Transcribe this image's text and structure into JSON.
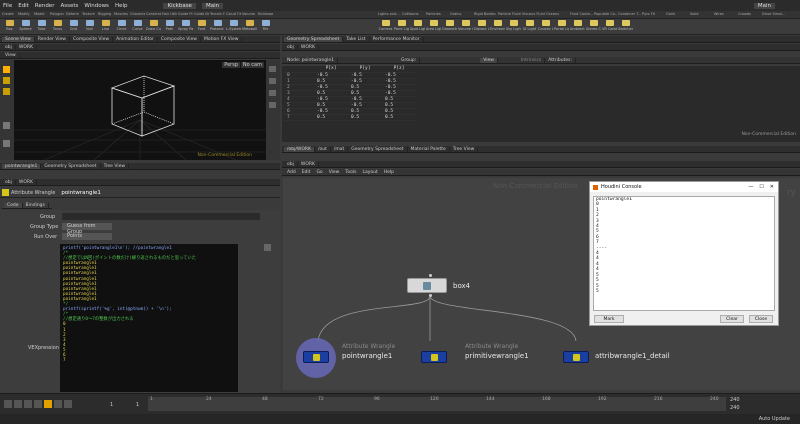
{
  "menubar": {
    "items": [
      "File",
      "Edit",
      "Render",
      "Assets",
      "Windows",
      "Help"
    ],
    "kickbase": "Kickbase",
    "main": "Main",
    "main_right": "Main"
  },
  "shelf_tabs_left": [
    "Create",
    "Modify",
    "Model",
    "Polygon",
    "Deform",
    "Texture",
    "Rigging",
    "Muscles",
    "Characters",
    "Constraints",
    "Hair Utils",
    "Guide Pro",
    "Guide Bru",
    "Terrain FX",
    "Cloud FX",
    "Volume",
    "Kickbase"
  ],
  "shelf_tabs_right": [
    "Lights and...",
    "Collisions",
    "Particles",
    "Grains",
    "Rigid Bodies",
    "Particle Fluids",
    "Viscous Fluids",
    "Oceans",
    "Fluid Conta...",
    "Populate Co...",
    "Container T...",
    "Pyro FX",
    "Cloth",
    "Solid",
    "Wires",
    "Crowds",
    "Drive Simul..."
  ],
  "shelf_tools_left": [
    "Box",
    "Sphere",
    "Tube",
    "Torus",
    "Grid",
    "Null",
    "Line",
    "Circle",
    "Curve",
    "Draw Curve",
    "Path",
    "Spray Paint",
    "Font",
    "Platonic Solids",
    "L-System",
    "Metaball",
    "File"
  ],
  "shelf_tools_right": [
    "Camera",
    "Point Light",
    "Spot Light",
    "Area Light",
    "Geometry Light",
    "Volume Light",
    "Distant Light",
    "Environment Light",
    "Sky Light",
    "GI Light",
    "Caustic Light",
    "Portal Light",
    "Ambient Light",
    "Stereo Camera",
    "VR Camera",
    "Switcher"
  ],
  "left_tabs": [
    "Scene View",
    "Render View",
    "Composite View",
    "Animation Editor",
    "Composite View",
    "Motion FX View"
  ],
  "obj_path": "obj",
  "work": "WORK",
  "viewport": {
    "label": "View",
    "persp": "Persp",
    "nocam": "No cam",
    "watermark": "Non-Commercial Edition"
  },
  "spreadsheet": {
    "tabs": [
      "Geometry Spreadsheet",
      "Take List",
      "Performance Monitor"
    ],
    "obj": "obj",
    "work": "WORK",
    "node_label": "Node: pointwrangle1",
    "group": "Group:",
    "view": "View",
    "intrinsics": "Intrinsics",
    "attributes": "Attributes:",
    "columns": [
      "P[x]",
      "P[y]",
      "P[z]"
    ],
    "rows": [
      [
        "0",
        "-0.5",
        "-0.5",
        "-0.5"
      ],
      [
        "1",
        "0.5",
        "-0.5",
        "-0.5"
      ],
      [
        "2",
        "-0.5",
        "0.5",
        "-0.5"
      ],
      [
        "3",
        "0.5",
        "0.5",
        "-0.5"
      ],
      [
        "4",
        "-0.5",
        "-0.5",
        "0.5"
      ],
      [
        "5",
        "0.5",
        "-0.5",
        "0.5"
      ],
      [
        "6",
        "-0.5",
        "0.5",
        "0.5"
      ],
      [
        "7",
        "0.5",
        "0.5",
        "0.5"
      ]
    ],
    "watermark": "Non-Commercial Edition"
  },
  "param": {
    "tabs": [
      "pointwrangle1",
      "Geometry Spreadsheet",
      "Tree View"
    ],
    "obj": "obj",
    "work": "WORK",
    "node_type": "Attribute Wrangle",
    "node_name": "pointwrangle1",
    "subtabs": [
      "Code",
      "Bindings"
    ],
    "group_label": "Group",
    "group_type_label": "Group Type",
    "group_type_value": "Guess from Group",
    "run_over_label": "Run Over",
    "run_over_value": "Points",
    "vex_label": "VEXpression"
  },
  "code_lines": [
    "printf('pointwrangle1\\n'); //pointwrangle1",
    "/*",
    "//想定ではN回(ポイントの数だけ)繰り返されるものだと思っていた",
    "pointwrangle1",
    "pointwrangle1",
    "pointwrangle1",
    "pointwrangle1",
    "pointwrangle1",
    "pointwrangle1",
    "pointwrangle1",
    "pointwrangle1",
    "*/",
    "",
    "printf(sprintf('%g', int(@ptnum)) + '\\n');",
    "/*",
    "//想定通り0～7の整数が出力される",
    "0",
    "1",
    "2",
    "3",
    "4",
    "5",
    "6",
    "7"
  ],
  "network": {
    "tabs": [
      "/obj/WORK",
      "/out",
      "/mat",
      "Geometry Spreadsheet",
      "Material Palette",
      "Tree View"
    ],
    "obj": "obj",
    "work": "WORK",
    "menus": [
      "Add",
      "Edit",
      "Go",
      "View",
      "Tools",
      "Layout",
      "Help"
    ],
    "watermark_left": "Non-Commercial Edition",
    "watermark_right": "ry",
    "nodes": {
      "box": "box4",
      "n1_type": "Attribute Wrangle",
      "n1_name": "pointwrangle1",
      "n2_type": "Attribute Wrangle",
      "n2_name": "primitivewrangle1",
      "n3_type": "Attribute Wrangle",
      "n3_name": "attribwrangle1_detail"
    }
  },
  "console": {
    "title": "Houdini Console",
    "lines": [
      "pointwrangle1",
      "0",
      "1",
      "2",
      "3",
      "4",
      "5",
      "6",
      "7",
      "----",
      "4",
      "4",
      "4",
      "4",
      "5",
      "5",
      "5",
      "5"
    ],
    "mark": "Mark",
    "clear": "Clear",
    "close": "Close"
  },
  "timeline": {
    "frame": "1",
    "frame2": "1",
    "ticks": [
      "1",
      "24",
      "48",
      "72",
      "96",
      "120",
      "144",
      "168",
      "192",
      "216",
      "240"
    ],
    "end1": "240",
    "end2": "240"
  },
  "status": {
    "auto_update": "Auto Update"
  },
  "colors": {
    "accent": "#ffb000",
    "node_blue": "#1b3fa0",
    "selected_ring": "#6e6ec8"
  }
}
